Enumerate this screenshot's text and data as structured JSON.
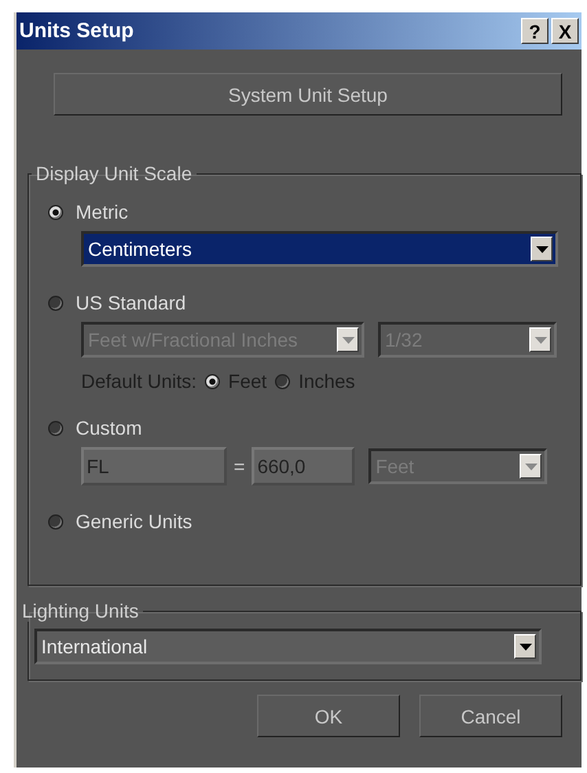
{
  "window": {
    "title": "Units Setup",
    "help_button": "?",
    "close_button": "X"
  },
  "system_unit_setup_button": "System Unit Setup",
  "display_unit_scale": {
    "label": "Display Unit Scale",
    "options": [
      {
        "kind": "metric",
        "label": "Metric",
        "selected": true,
        "dropdown": {
          "value": "Centimeters",
          "disabled": false,
          "highlighted": true
        }
      },
      {
        "kind": "us_standard",
        "label": "US Standard",
        "selected": false,
        "dropdowns": [
          {
            "value": "Feet w/Fractional Inches",
            "disabled": true
          },
          {
            "value": "1/32",
            "disabled": true
          }
        ],
        "default_units": {
          "label": "Default Units:",
          "choices": [
            {
              "label": "Feet",
              "selected": true
            },
            {
              "label": "Inches",
              "selected": false
            }
          ]
        }
      },
      {
        "kind": "custom",
        "label": "Custom",
        "selected": false,
        "name_field": "FL",
        "equals": "=",
        "value_field": "660,0",
        "dropdown": {
          "value": "Feet",
          "disabled": true
        }
      },
      {
        "kind": "generic",
        "label": "Generic Units",
        "selected": false
      }
    ]
  },
  "lighting_units": {
    "label": "Lighting Units",
    "dropdown": {
      "value": "International",
      "disabled": false,
      "highlighted": false
    }
  },
  "buttons": [
    "OK",
    "Cancel"
  ]
}
